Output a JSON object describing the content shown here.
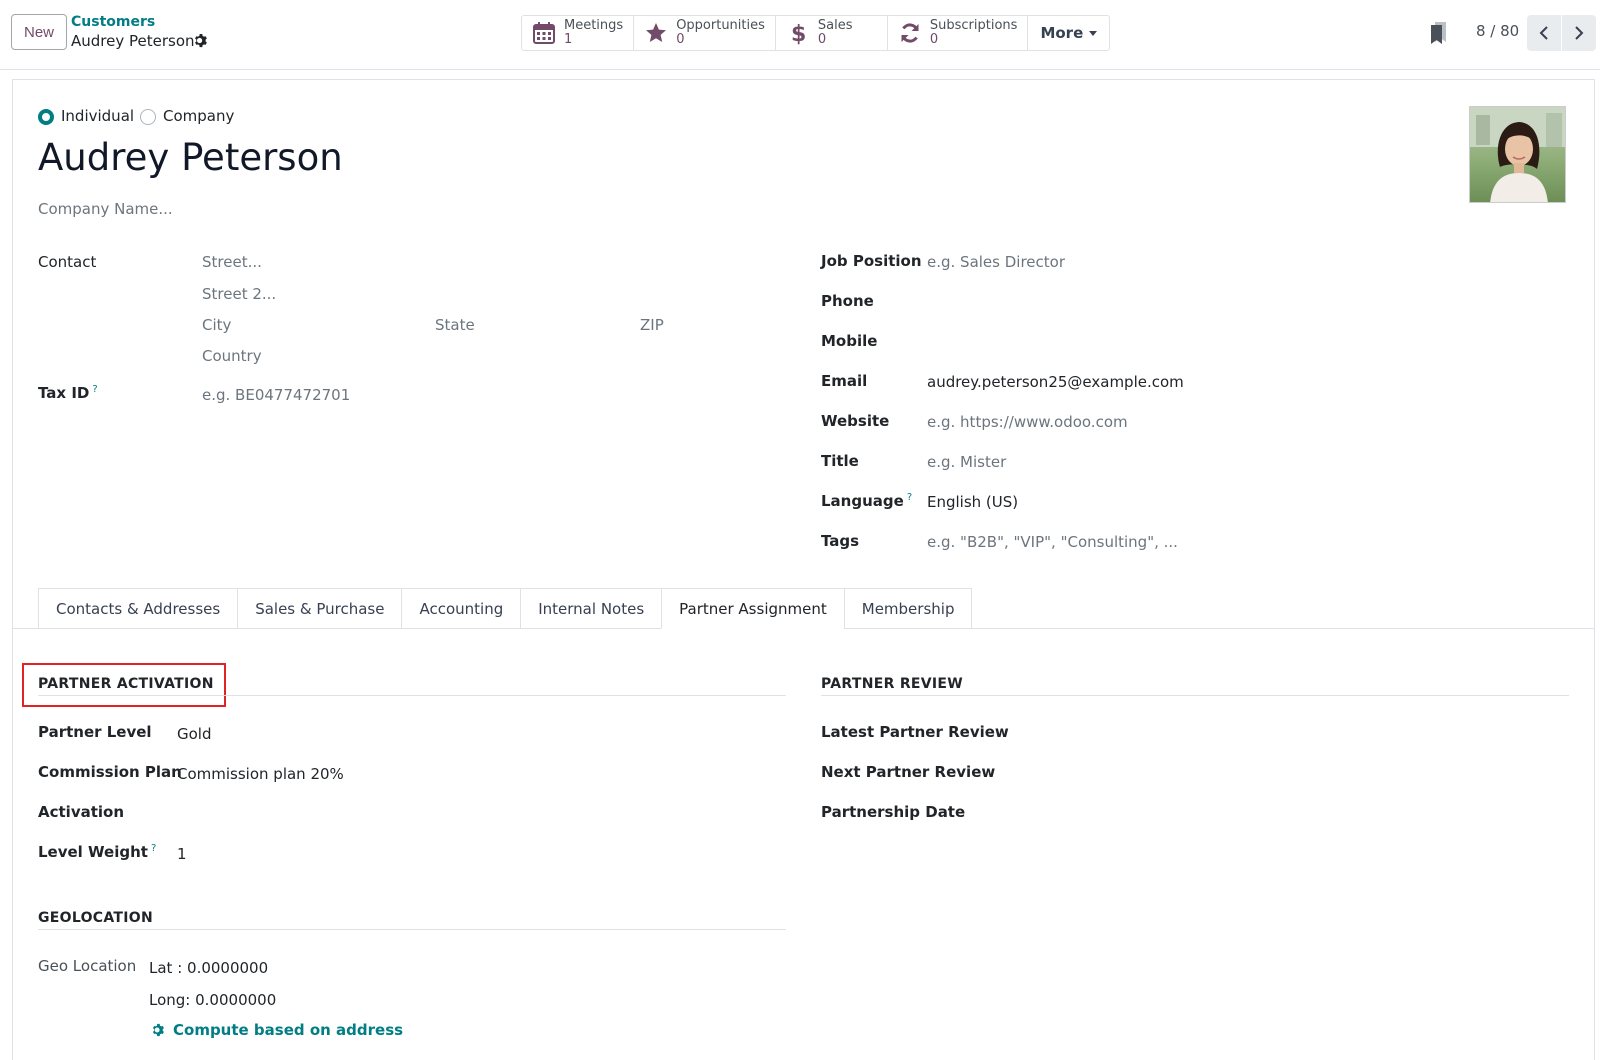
{
  "control_panel": {
    "new_button": "New",
    "breadcrumb_parent": "Customers",
    "breadcrumb_current": "Audrey Peterson",
    "smart_buttons": [
      {
        "label": "Meetings",
        "value": "1",
        "icon": "calendar-icon"
      },
      {
        "label": "Opportunities",
        "value": "0",
        "icon": "star-icon"
      },
      {
        "label": "Sales",
        "value": "0",
        "icon": "dollar-icon"
      },
      {
        "label": "Subscriptions",
        "value": "0",
        "icon": "refresh-icon"
      }
    ],
    "more_label": "More",
    "pager": "8 / 80"
  },
  "form": {
    "type_individual": "Individual",
    "type_company": "Company",
    "name": "Audrey Peterson",
    "company_placeholder": "Company Name...",
    "contact_label": "Contact",
    "street_placeholder": "Street...",
    "street2_placeholder": "Street 2...",
    "city_placeholder": "City",
    "state_placeholder": "State",
    "zip_placeholder": "ZIP",
    "country_placeholder": "Country",
    "tax_id_label": "Tax ID",
    "tax_id_help": "?",
    "tax_id_placeholder": "e.g. BE0477472701",
    "job_position_label": "Job Position",
    "job_position_placeholder": "e.g. Sales Director",
    "phone_label": "Phone",
    "mobile_label": "Mobile",
    "email_label": "Email",
    "email_value": "audrey.peterson25@example.com",
    "website_label": "Website",
    "website_placeholder": "e.g. https://www.odoo.com",
    "title_label": "Title",
    "title_placeholder": "e.g. Mister",
    "language_label": "Language",
    "language_help": "?",
    "language_value": "English (US)",
    "tags_label": "Tags",
    "tags_placeholder": "e.g. \"B2B\", \"VIP\", \"Consulting\", ..."
  },
  "tabs": [
    {
      "label": "Contacts & Addresses"
    },
    {
      "label": "Sales & Purchase"
    },
    {
      "label": "Accounting"
    },
    {
      "label": "Internal Notes"
    },
    {
      "label": "Partner Assignment",
      "active": true
    },
    {
      "label": "Membership"
    }
  ],
  "partner_activation": {
    "title": "PARTNER ACTIVATION",
    "partner_level_label": "Partner Level",
    "partner_level_value": "Gold",
    "commission_plan_label": "Commission Plan",
    "commission_plan_value": "Commission plan 20%",
    "activation_label": "Activation",
    "level_weight_label": "Level Weight",
    "level_weight_help": "?",
    "level_weight_value": "1"
  },
  "partner_review": {
    "title": "PARTNER REVIEW",
    "latest_label": "Latest Partner Review",
    "next_label": "Next Partner Review",
    "partnership_date_label": "Partnership Date"
  },
  "geolocation": {
    "title": "GEOLOCATION",
    "geo_location_label": "Geo Location",
    "lat": "Lat : 0.0000000",
    "long": "Long: 0.0000000",
    "compute_label": "Compute based on address"
  },
  "colors": {
    "accent": "#017e84",
    "brand": "#714b67",
    "highlight": "#e02424"
  }
}
